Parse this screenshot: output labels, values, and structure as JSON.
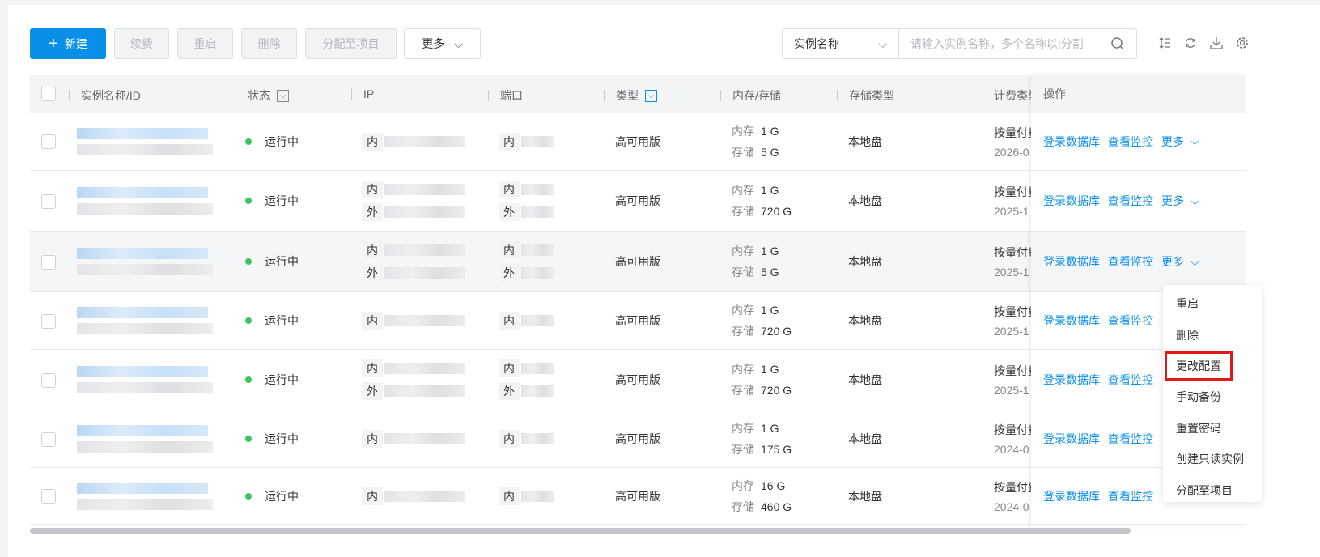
{
  "toolbar": {
    "new": "新建",
    "renew": "续费",
    "restart": "重启",
    "delete": "删除",
    "assign": "分配至项目",
    "more": "更多"
  },
  "search": {
    "field": "实例名称",
    "placeholder": "请输入实例名称，多个名称以|分割"
  },
  "columns": {
    "name": "实例名称/ID",
    "status": "状态",
    "ip": "IP",
    "port": "端口",
    "type": "类型",
    "mem": "内存/存储",
    "storage_type": "存储类型",
    "billing": "计费类型",
    "ops": "操作"
  },
  "labels": {
    "inner": "内",
    "outer": "外",
    "mem": "内存",
    "storage": "存储",
    "login": "登录数据库",
    "monitor": "查看监控",
    "more": "更多"
  },
  "rows": [
    {
      "status": "运行中",
      "type": "高可用版",
      "mem": "1 G",
      "storage": "5 G",
      "storage_type": "本地盘",
      "billing": "按量付费",
      "date": "2026-0",
      "outer": false,
      "more": true
    },
    {
      "status": "运行中",
      "type": "高可用版",
      "mem": "1 G",
      "storage": "720 G",
      "storage_type": "本地盘",
      "billing": "按量付费",
      "date": "2025-1",
      "outer": true,
      "more": true
    },
    {
      "status": "运行中",
      "type": "高可用版",
      "mem": "1 G",
      "storage": "5 G",
      "storage_type": "本地盘",
      "billing": "按量付费",
      "date": "2025-1",
      "outer": true,
      "more": true
    },
    {
      "status": "运行中",
      "type": "高可用版",
      "mem": "1 G",
      "storage": "720 G",
      "storage_type": "本地盘",
      "billing": "按量付费",
      "date": "2025-1",
      "outer": false,
      "more": false
    },
    {
      "status": "运行中",
      "type": "高可用版",
      "mem": "1 G",
      "storage": "720 G",
      "storage_type": "本地盘",
      "billing": "按量付费",
      "date": "2025-1",
      "outer": true,
      "more": false
    },
    {
      "status": "运行中",
      "type": "高可用版",
      "mem": "1 G",
      "storage": "175 G",
      "storage_type": "本地盘",
      "billing": "按量付费",
      "date": "2024-0",
      "outer": false,
      "more": false
    },
    {
      "status": "运行中",
      "type": "高可用版",
      "mem": "16 G",
      "storage": "460 G",
      "storage_type": "本地盘",
      "billing": "按量付费",
      "date": "2024-0",
      "outer": false,
      "more": false
    }
  ],
  "menu": [
    "重启",
    "删除",
    "更改配置",
    "手动备份",
    "重置密码",
    "创建只读实例",
    "分配至项目"
  ],
  "colors": {
    "accent": "#0a8fe8",
    "running": "#3bc45f",
    "highlight": "#e01818"
  }
}
